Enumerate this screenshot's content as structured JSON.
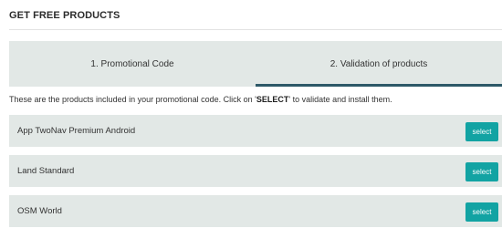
{
  "page": {
    "title": "GET FREE PRODUCTS"
  },
  "tabs": [
    {
      "label": "1. Promotional Code",
      "active": false
    },
    {
      "label": "2. Validation of products",
      "active": true
    }
  ],
  "instructions": {
    "before": "These are the products included in your promotional code. Click on '",
    "emphasis": "SELECT",
    "after": "' to validate and install them."
  },
  "products": [
    {
      "name": "App TwoNav Premium Android",
      "button_label": "select"
    },
    {
      "name": "Land Standard",
      "button_label": "select"
    },
    {
      "name": "OSM World",
      "button_label": "select"
    }
  ],
  "colors": {
    "accent": "#12a3a3",
    "tab_active_border": "#2e5968",
    "panel_background": "#e2e8e6"
  }
}
